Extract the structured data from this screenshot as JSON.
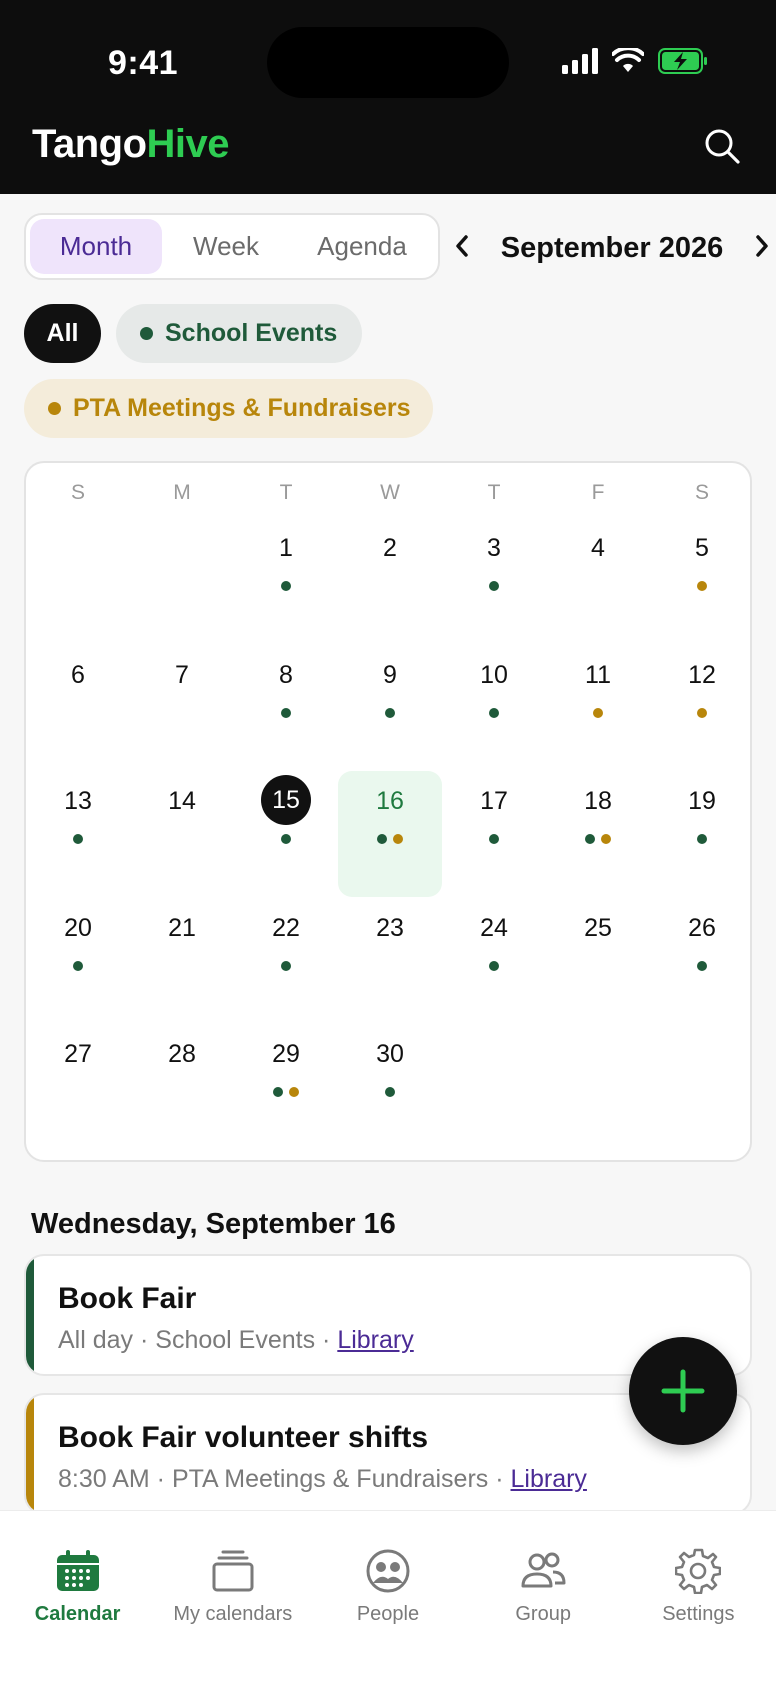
{
  "status_bar": {
    "time": "9:41"
  },
  "app": {
    "brand_primary": "Tango",
    "brand_accent": "Hive",
    "accent_color": "#2ecc52"
  },
  "view_switch": {
    "options": [
      {
        "label": "Month",
        "active": true
      },
      {
        "label": "Week",
        "active": false
      },
      {
        "label": "Agenda",
        "active": false
      }
    ]
  },
  "month_nav": {
    "label": "September 2026",
    "prev_icon": "chevron-left-icon",
    "next_icon": "chevron-right-icon"
  },
  "filters": {
    "all": "All",
    "school": {
      "label": "School Events",
      "color": "#1f5a3a"
    },
    "pta": {
      "label": "PTA Meetings & Fundraisers",
      "color": "#b8860b"
    }
  },
  "calendar": {
    "weekdays": [
      "S",
      "M",
      "T",
      "W",
      "T",
      "F",
      "S"
    ],
    "first_weekday_index": 2,
    "today": 15,
    "selected": 16,
    "days": [
      {
        "n": "1",
        "dots": [
          "school"
        ]
      },
      {
        "n": "2",
        "dots": []
      },
      {
        "n": "3",
        "dots": [
          "school"
        ]
      },
      {
        "n": "4",
        "dots": []
      },
      {
        "n": "5",
        "dots": [
          "pta"
        ]
      },
      {
        "n": "6",
        "dots": []
      },
      {
        "n": "7",
        "dots": []
      },
      {
        "n": "8",
        "dots": [
          "school"
        ]
      },
      {
        "n": "9",
        "dots": [
          "school"
        ]
      },
      {
        "n": "10",
        "dots": [
          "school"
        ]
      },
      {
        "n": "11",
        "dots": [
          "pta"
        ]
      },
      {
        "n": "12",
        "dots": [
          "pta"
        ]
      },
      {
        "n": "13",
        "dots": [
          "school"
        ]
      },
      {
        "n": "14",
        "dots": []
      },
      {
        "n": "15",
        "dots": [
          "school"
        ]
      },
      {
        "n": "16",
        "dots": [
          "school",
          "pta"
        ]
      },
      {
        "n": "17",
        "dots": [
          "school"
        ]
      },
      {
        "n": "18",
        "dots": [
          "school",
          "pta"
        ]
      },
      {
        "n": "19",
        "dots": [
          "school"
        ]
      },
      {
        "n": "20",
        "dots": [
          "school"
        ]
      },
      {
        "n": "21",
        "dots": []
      },
      {
        "n": "22",
        "dots": [
          "school"
        ]
      },
      {
        "n": "23",
        "dots": []
      },
      {
        "n": "24",
        "dots": [
          "school"
        ]
      },
      {
        "n": "25",
        "dots": []
      },
      {
        "n": "26",
        "dots": [
          "school"
        ]
      },
      {
        "n": "27",
        "dots": []
      },
      {
        "n": "28",
        "dots": []
      },
      {
        "n": "29",
        "dots": [
          "school",
          "pta"
        ]
      },
      {
        "n": "30",
        "dots": [
          "school"
        ]
      }
    ]
  },
  "selected_date_label": "Wednesday, September 16",
  "events": [
    {
      "title": "Book Fair",
      "time": "All day",
      "calendar": "School Events",
      "location": "Library",
      "color": "#1f5a3a",
      "separator": " · "
    },
    {
      "title": "Book Fair volunteer shifts",
      "time": "8:30 AM",
      "calendar": "PTA Meetings & Fundraisers",
      "location": "Library",
      "color": "#b8860b",
      "separator": " · "
    }
  ],
  "fab": {
    "icon": "plus-icon"
  },
  "tabbar": {
    "items": [
      {
        "label": "Calendar",
        "icon": "calendar-icon",
        "active": true
      },
      {
        "label": "My calendars",
        "icon": "stacked-calendars-icon",
        "active": false
      },
      {
        "label": "People",
        "icon": "people-icon",
        "active": false
      },
      {
        "label": "Group",
        "icon": "group-icon",
        "active": false
      },
      {
        "label": "Settings",
        "icon": "gear-icon",
        "active": false
      }
    ]
  }
}
